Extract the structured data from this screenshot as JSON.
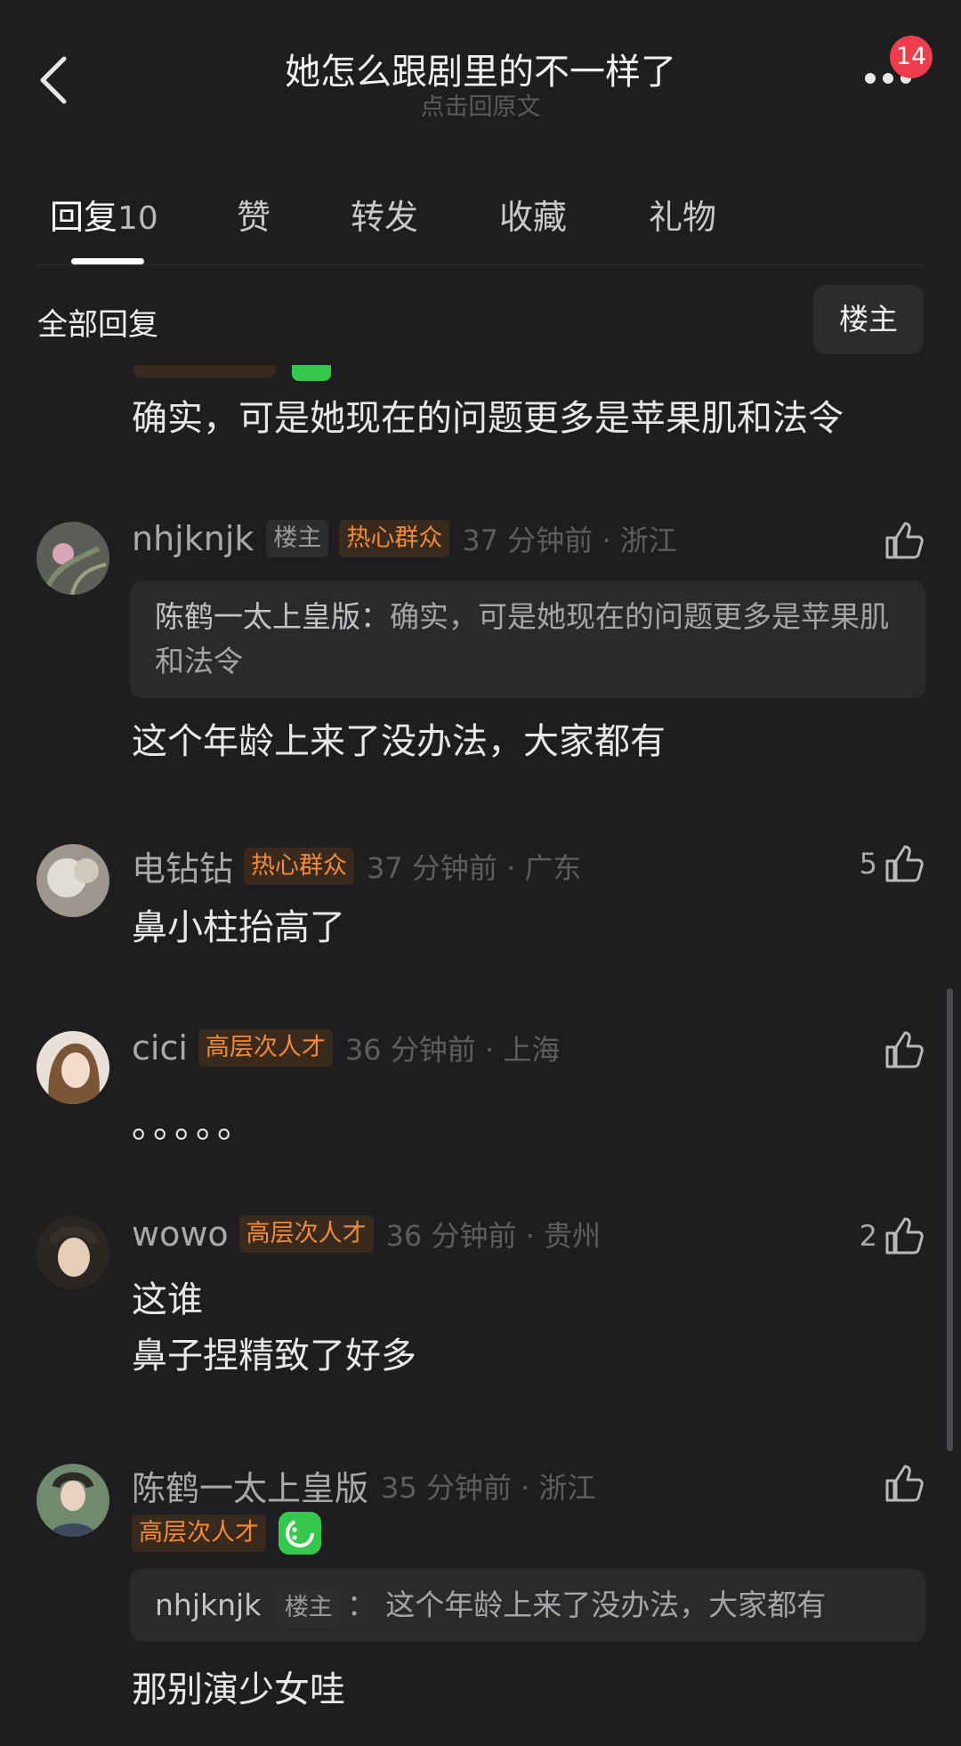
{
  "header": {
    "title": "她怎么跟剧里的不一样了",
    "subtitle": "点击回原文",
    "badge": "14"
  },
  "tabs": [
    {
      "label": "回复",
      "count": "10"
    },
    {
      "label": "赞"
    },
    {
      "label": "转发"
    },
    {
      "label": "收藏"
    },
    {
      "label": "礼物"
    }
  ],
  "section": {
    "title": "全部回复",
    "filter": "楼主"
  },
  "partial_comment": {
    "text": "确实，可是她现在的问题更多是苹果肌和法令"
  },
  "comments": [
    {
      "name": "nhjknjk",
      "op_tag": "楼主",
      "tag": "热心群众",
      "time": "37 分钟前 · 浙江",
      "quote_name": "陈鹤一太上皇版：",
      "quote_text": "确实，可是她现在的问题更多是苹果肌和法令",
      "text": "这个年龄上来了没办法，大家都有",
      "likes": ""
    },
    {
      "name": "电钻钻",
      "tag": "热心群众",
      "time": "37 分钟前 · 广东",
      "text": "鼻小柱抬高了",
      "likes": "5"
    },
    {
      "name": "cici",
      "tag": "高层次人才",
      "time": "36 分钟前 · 上海",
      "text": "。。。。。",
      "likes": ""
    },
    {
      "name": "wowo",
      "tag": "高层次人才",
      "time": "36 分钟前 · 贵州",
      "text": "这谁",
      "text2": "鼻子捏精致了好多",
      "likes": "2"
    },
    {
      "name": "陈鹤一太上皇版",
      "tag": "高层次人才",
      "time": "35 分钟前 · 浙江",
      "quote_name": "nhjknjk",
      "quote_op": "楼主",
      "quote_text": "：  这个年龄上来了没办法，大家都有",
      "text": "那别演少女哇",
      "likes": ""
    }
  ],
  "colors": {
    "background": "#1e1e20",
    "badge_red": "#ee3d4c",
    "tag_orange": "#f08b3a",
    "accent_green": "#36c74e"
  }
}
